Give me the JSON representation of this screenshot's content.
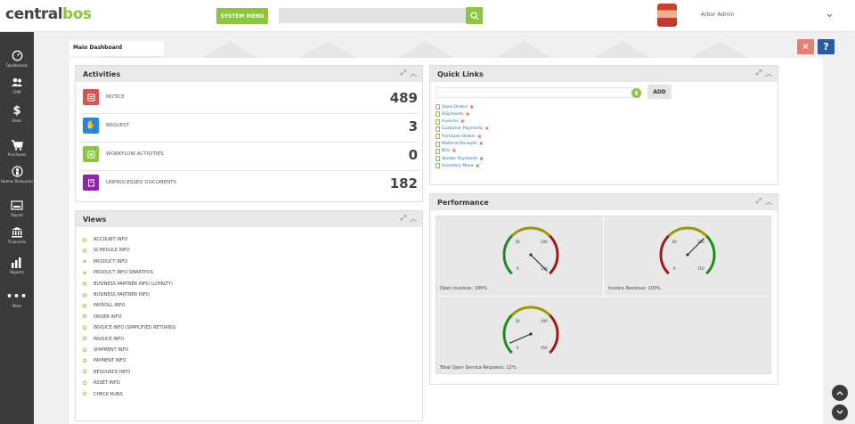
{
  "header": {
    "logo_main": "central",
    "logo_accent": "bos",
    "system_menu_label": "SYSTEM MENU",
    "search_placeholder": "",
    "username": "Arbor Admin"
  },
  "sidebar": {
    "items": [
      {
        "label": "Dashboards",
        "icon": "gauge-icon"
      },
      {
        "label": "CRM",
        "icon": "users-icon"
      },
      {
        "label": "Sales",
        "icon": "dollar-icon"
      },
      {
        "label": "Purchases",
        "icon": "cart-icon"
      },
      {
        "label": "Human Resources",
        "icon": "person-icon"
      },
      {
        "label": "Payroll",
        "icon": "payroll-icon"
      },
      {
        "label": "Financials",
        "icon": "bank-icon"
      },
      {
        "label": "Reports",
        "icon": "bar-chart-icon"
      },
      {
        "label": "More",
        "icon": "more-icon"
      }
    ]
  },
  "tabs": {
    "main_dashboard": "Main Dashboard"
  },
  "toolbar": {
    "close_symbol": "×",
    "help_symbol": "?"
  },
  "activities": {
    "title": "Activities",
    "rows": [
      {
        "label": "NOTICE",
        "count": "489",
        "color": "#d9534f",
        "icon": "notice-icon"
      },
      {
        "label": "REQUEST",
        "count": "3",
        "color": "#1e88e5",
        "icon": "hand-icon"
      },
      {
        "label": "WORKFLOW ACTIVITIES",
        "count": "0",
        "color": "#8cc63f",
        "icon": "workflow-icon"
      },
      {
        "label": "UNPROCESSED DOCUMENTS",
        "count": "182",
        "color": "#8e24aa",
        "icon": "document-icon"
      }
    ]
  },
  "views": {
    "title": "Views",
    "items": [
      "ACCOUNT INFO",
      "SCHEDULE INFO",
      "PRODUCT INFO",
      "PRODUCT INFO SMARTPOS",
      "BUSINESS PARTNER INFO (LOYALTY)",
      "BUSINESS PARTNER INFO",
      "PAYROLL INFO",
      "ORDER INFO",
      "INVOICE INFO (SIMPLIFIED RETURNS)",
      "INVOICE INFO",
      "SHIPMENT INFO",
      "PAYMENT INFO",
      "RESOURCE INFO",
      "ASSET INFO",
      "CHECK RUNS"
    ]
  },
  "quick_links": {
    "title": "Quick Links",
    "input_value": "",
    "add_label": "ADD",
    "items": [
      "Sales Orders",
      "Shipments",
      "Invoices",
      "Customer Payments",
      "Purchase Orders",
      "Material Receipts",
      "Bills",
      "Vendor Payments",
      "Inventory Move"
    ]
  },
  "performance": {
    "title": "Performance",
    "gauges": [
      {
        "label": "Open Invoices: 180%",
        "value_pct": 180,
        "ticks": [
          "0",
          "50",
          "100",
          "150"
        ],
        "colors": [
          "#1e8c1e",
          "#9a9a00",
          "#9b1b1b"
        ]
      },
      {
        "label": "Invoice Revenue: 100%",
        "value_pct": 100,
        "ticks": [
          "0",
          "50",
          "100",
          "150"
        ],
        "colors": [
          "#9b1b1b",
          "#9a9a00",
          "#1e8c1e"
        ]
      },
      {
        "label": "Total Open Service Requests: 12%",
        "value_pct": 12,
        "ticks": [
          "0",
          "50",
          "100",
          "150"
        ],
        "colors": [
          "#1e8c1e",
          "#9a9a00",
          "#9b1b1b"
        ]
      }
    ]
  }
}
